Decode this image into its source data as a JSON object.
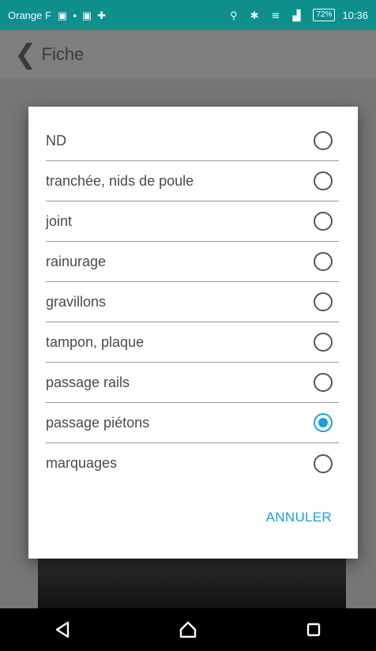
{
  "status_bar": {
    "carrier": "Orange F",
    "battery": "72%",
    "time": "10:36"
  },
  "app_bar": {
    "back_icon": "chevron-left-icon",
    "title": "Fiche"
  },
  "dialog": {
    "options": [
      {
        "label": "ND",
        "checked": false
      },
      {
        "label": "tranchée, nids de poule",
        "checked": false
      },
      {
        "label": "joint",
        "checked": false
      },
      {
        "label": "rainurage",
        "checked": false
      },
      {
        "label": "gravillons",
        "checked": false
      },
      {
        "label": "tampon, plaque",
        "checked": false
      },
      {
        "label": "passage rails",
        "checked": false
      },
      {
        "label": "passage piétons",
        "checked": true
      },
      {
        "label": "marquages",
        "checked": false
      }
    ],
    "cancel_label": "ANNULER"
  },
  "colors": {
    "status_bar": "#0f8f8c",
    "accent": "#1aa0d8"
  }
}
